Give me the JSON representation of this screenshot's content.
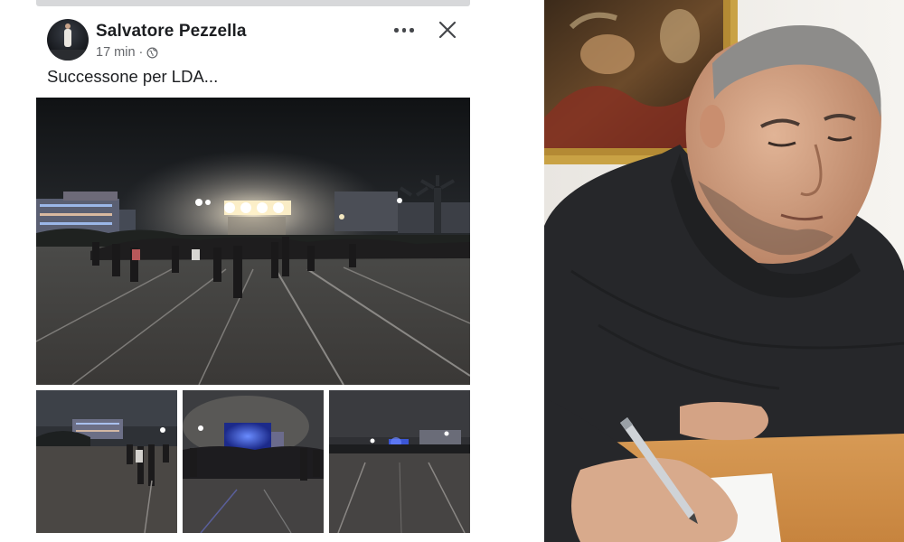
{
  "post": {
    "author": "Salvatore Pezzella",
    "time": "17 min",
    "separator": "·",
    "privacy_icon": "globe-icon",
    "caption": "Successone per LDA...",
    "more_icon": "more-options-icon",
    "close_icon": "close-icon"
  },
  "colors": {
    "text_primary": "#1c1e21",
    "text_secondary": "#65676b",
    "panel_background": "#ffffff",
    "night_sky": "#1b1c1e",
    "stage_light": "#f4e6c2"
  }
}
